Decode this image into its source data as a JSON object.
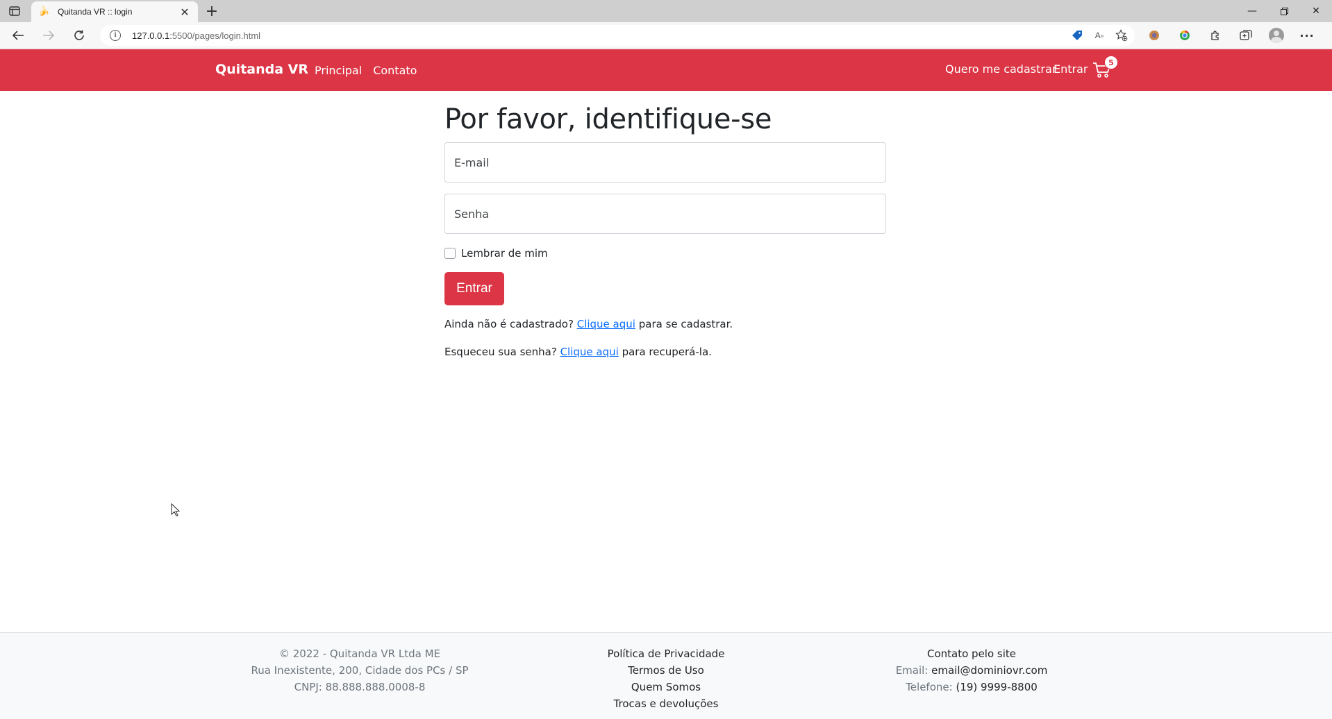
{
  "browser": {
    "tab_title": "Quitanda VR :: login",
    "url_host": "127.0.0.1",
    "url_rest": ":5500/pages/login.html"
  },
  "navbar": {
    "brand": "Quitanda VR",
    "links": [
      "Principal",
      "Contato"
    ],
    "register_link": "Quero me cadastrar",
    "login_link": "Entrar",
    "cart_count": "5",
    "accent_color": "#dc3545"
  },
  "login": {
    "title": "Por favor, identifique-se",
    "email_placeholder": "E-mail",
    "password_placeholder": "Senha",
    "remember_label": "Lembrar de mim",
    "submit_label": "Entrar",
    "register_prefix": "Ainda não é cadastrado?",
    "register_link": "Clique aqui",
    "register_suffix": "para se cadastrar.",
    "recover_prefix": "Esqueceu sua senha?",
    "recover_link": "Clique aqui",
    "recover_suffix": "para recuperá-la."
  },
  "footer": {
    "copyright": "© 2022 - Quitanda VR Ltda ME",
    "address": "Rua Inexistente, 200, Cidade dos PCs / SP",
    "cnpj": "CNPJ: 88.888.888.0008-8",
    "links": [
      "Política de Privacidade",
      "Termos de Uso",
      "Quem Somos",
      "Trocas e devoluções"
    ],
    "contact_title": "Contato pelo site",
    "email_label": "Email:",
    "email_value": "email@dominiovr.com",
    "phone_label": "Telefone:",
    "phone_value": "(19) 9999-8800"
  }
}
